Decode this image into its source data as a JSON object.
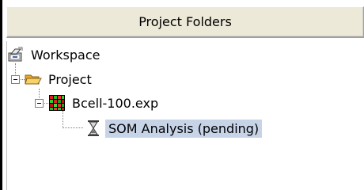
{
  "panel": {
    "title": "Project Folders"
  },
  "tree": {
    "nodes": [
      {
        "label": "Workspace",
        "icon": "workspace-icon"
      },
      {
        "label": "Project",
        "icon": "folder-open-icon"
      },
      {
        "label": "Bcell-100.exp",
        "icon": "heatmap-icon"
      },
      {
        "label": "SOM Analysis (pending)",
        "icon": "hourglass-icon",
        "selected": true
      }
    ]
  },
  "colors": {
    "selection": "#c7d4e8",
    "header_bg": "#ece9d8",
    "folder": "#f4c542"
  }
}
